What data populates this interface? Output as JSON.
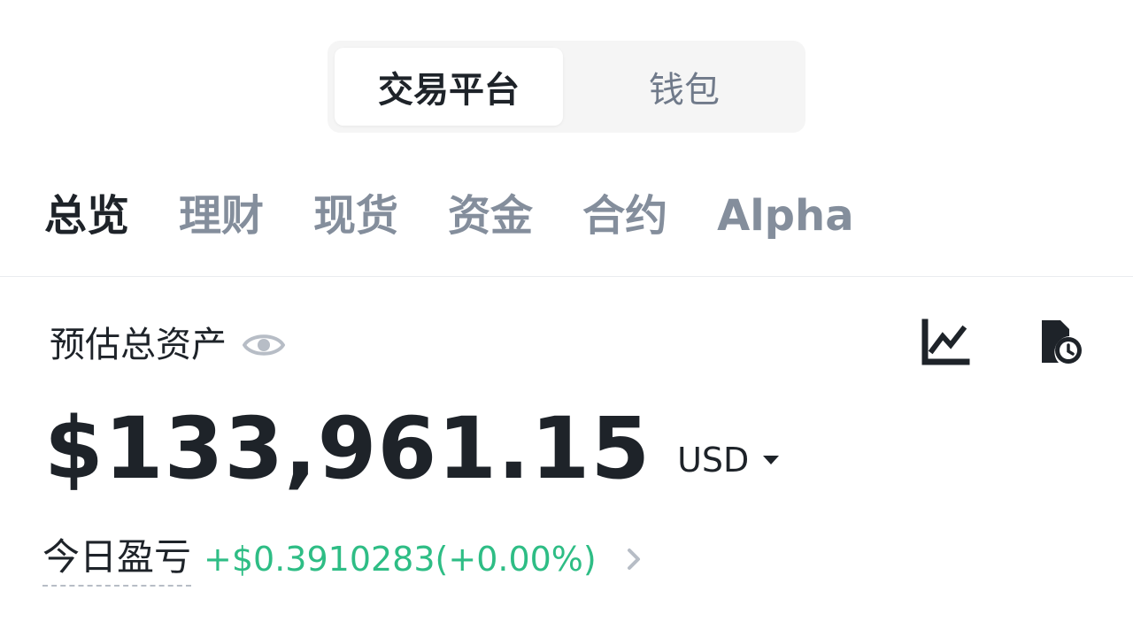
{
  "segmented": {
    "active_label": "交易平台",
    "inactive_label": "钱包"
  },
  "tabs": [
    {
      "label": "总览",
      "active": true
    },
    {
      "label": "理财",
      "active": false
    },
    {
      "label": "现货",
      "active": false
    },
    {
      "label": "资金",
      "active": false
    },
    {
      "label": "合约",
      "active": false
    },
    {
      "label": "Alpha",
      "active": false
    }
  ],
  "assets": {
    "label": "预估总资产",
    "balance": "$133,961.15",
    "currency": "USD",
    "icons": {
      "visibility": "eye-icon",
      "chart": "chart-icon",
      "history": "history-icon",
      "currency_caret": "caret-down-icon"
    }
  },
  "pnl": {
    "label": "今日盈亏",
    "value": "+$0.3910283(+0.00%)",
    "color": "#2ebd85"
  },
  "colors": {
    "primary_text": "#1e2329",
    "secondary_text": "#848e9c",
    "positive": "#2ebd85",
    "segment_bg": "#f5f5f5"
  }
}
